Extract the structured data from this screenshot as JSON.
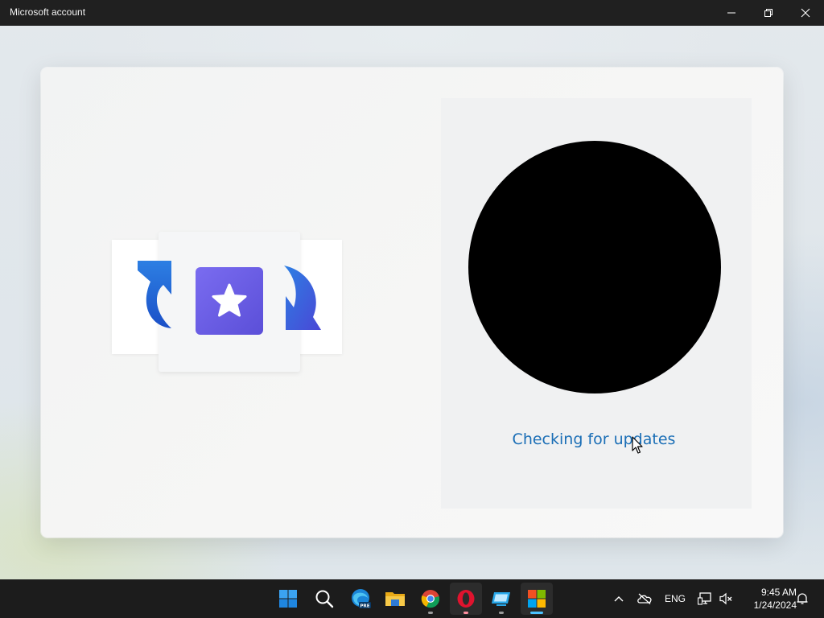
{
  "window": {
    "title": "Microsoft account",
    "controls": {
      "minimize": "minimize",
      "maximize": "restore",
      "close": "close"
    }
  },
  "dialog": {
    "status_text": "Checking for updates",
    "illustration": "store-update-illustration",
    "colors": {
      "status_text": "#1a6eb6",
      "store_icon": "#6a5ee6",
      "arrow_blue": "#1f6fd6"
    }
  },
  "taskbar": {
    "apps": [
      {
        "name": "start",
        "icon": "windows-logo-icon"
      },
      {
        "name": "search",
        "icon": "search-icon"
      },
      {
        "name": "edge",
        "icon": "edge-beta-icon",
        "badge": "PRE"
      },
      {
        "name": "file-explorer",
        "icon": "folder-icon"
      },
      {
        "name": "chrome",
        "icon": "chrome-icon"
      },
      {
        "name": "opera",
        "icon": "opera-icon"
      },
      {
        "name": "remote",
        "icon": "remote-desktop-icon"
      },
      {
        "name": "microsoft-store",
        "icon": "store-icon"
      }
    ],
    "tray": {
      "language": "ENG",
      "time": "9:45 AM",
      "date": "1/24/2024"
    }
  }
}
